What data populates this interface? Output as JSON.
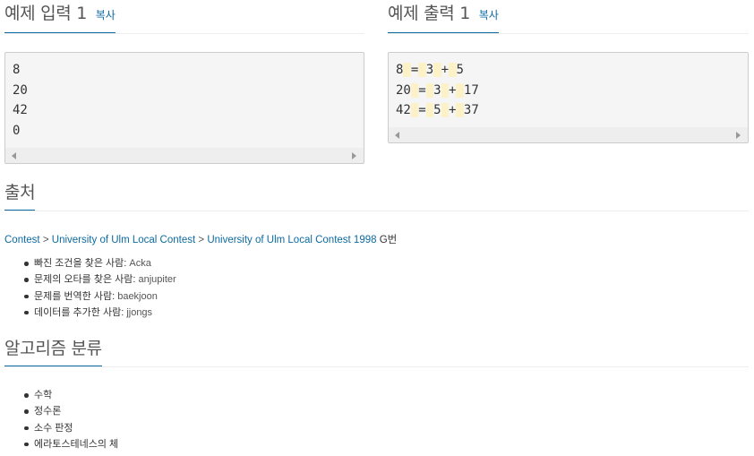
{
  "sample_input": {
    "title": "예제 입력 1",
    "copy_label": "복사",
    "lines": [
      "8",
      "20",
      "42",
      "0"
    ]
  },
  "sample_output": {
    "title": "예제 출력 1",
    "copy_label": "복사",
    "rows": [
      [
        "8",
        "=",
        "3",
        "+",
        "5"
      ],
      [
        "20",
        "=",
        "3",
        "+",
        "17"
      ],
      [
        "42",
        "=",
        "5",
        "+",
        "37"
      ]
    ]
  },
  "source": {
    "title": "출처",
    "breadcrumb": {
      "link1": "Contest",
      "sep": ">",
      "link2": "University of Ulm Local Contest",
      "link3": "University of Ulm Local Contest 1998",
      "suffix": "G번"
    },
    "credits": [
      {
        "label": "빠진 조건을 찾은 사람:",
        "value": "Acka"
      },
      {
        "label": "문제의 오타를 찾은 사람:",
        "value": "anjupiter"
      },
      {
        "label": "문제를 번역한 사람:",
        "value": "baekjoon"
      },
      {
        "label": "데이터를 추가한 사람:",
        "value": "jjongs"
      }
    ]
  },
  "algorithms": {
    "title": "알고리즘 분류",
    "items": [
      "수학",
      "정수론",
      "소수 판정",
      "에라토스테네스의 체"
    ]
  },
  "colors": {
    "link": "#0d6aa0",
    "code_bg": "#f5f5f5",
    "highlight": "#fdf1c8"
  }
}
